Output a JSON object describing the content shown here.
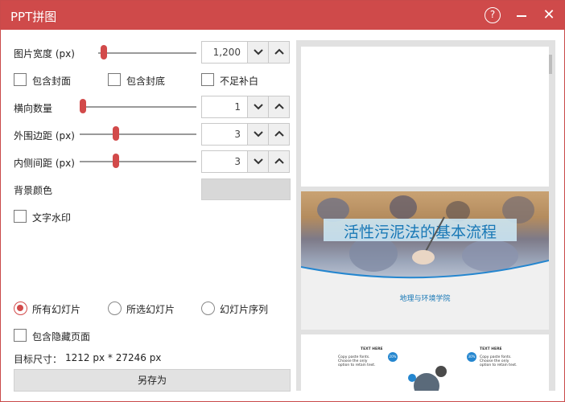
{
  "window": {
    "title": "PPT拼图"
  },
  "settings": {
    "image_width_label": "图片宽度 (px)",
    "image_width_value": "1,200",
    "image_width_level": 0.1,
    "include_cover_label": "包含封面",
    "include_back_label": "包含封底",
    "fill_blank_label": "不足补白",
    "columns_label": "横向数量",
    "columns_value": "1",
    "columns_level": 0.0,
    "outer_margin_label": "外围边距 (px)",
    "outer_margin_value": "3",
    "outer_margin_level": 0.3,
    "inner_spacing_label": "内侧间距 (px)",
    "inner_spacing_value": "3",
    "inner_spacing_level": 0.3,
    "bg_color_label": "背景颜色",
    "bg_color_value": "#d8d8d8",
    "watermark_label": "文字水印"
  },
  "selection": {
    "all_slides_label": "所有幻灯片",
    "selected_slides_label": "所选幻灯片",
    "slide_sequence_label": "幻灯片序列",
    "include_hidden_label": "包含隐藏页面",
    "target_size_label": "目标尺寸：",
    "target_size_value": "1212 px *  27246 px"
  },
  "actions": {
    "save_as_label": "另存为"
  },
  "preview": {
    "slide2_title": "活性污泥法的基本流程",
    "slide2_school": "地理与环境学院",
    "slide3_text_here_1": "TEXT HERE",
    "slide3_text_here_2": "TEXT HERE",
    "slide3_copy_1": "Copy paste fonts. Choose the only option to retain text.",
    "slide3_copy_2": "Copy paste fonts. Choose the only option to retain text.",
    "slide3_badge_1": "20%",
    "slide3_badge_2": "30%"
  },
  "colors": {
    "accent": "#d24a4a",
    "titlebar": "#cf4a4a",
    "preview_title": "#1878b6"
  }
}
